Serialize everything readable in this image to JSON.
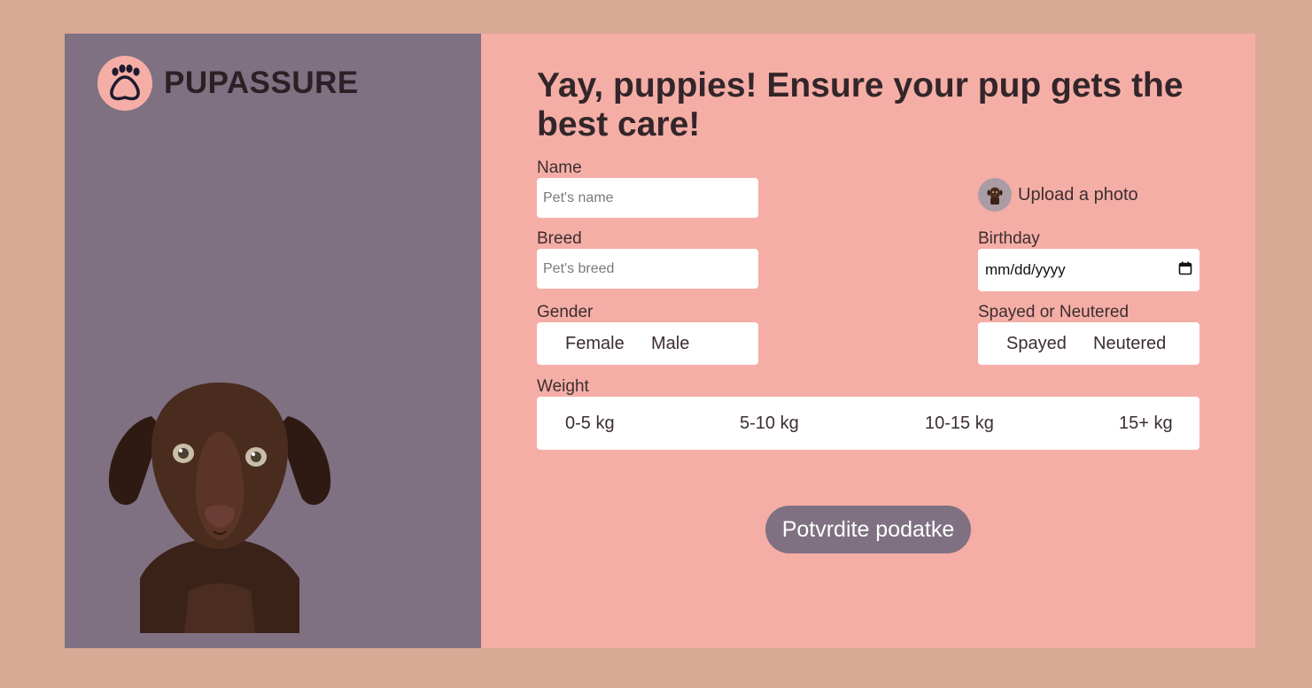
{
  "brand": {
    "name": "PUPASSURE",
    "logo_icon": "paw-icon"
  },
  "sidebar": {
    "image": "puppy-photo"
  },
  "form": {
    "title": "Yay, puppies! Ensure your pup gets the best care!",
    "name": {
      "label": "Name",
      "placeholder": "Pet's name"
    },
    "breed": {
      "label": "Breed",
      "placeholder": "Pet's breed"
    },
    "upload": {
      "label": "Upload a photo",
      "icon": "puppy-avatar-icon"
    },
    "birthday": {
      "label": "Birthday",
      "value": "mm/dd/yyyy",
      "icon": "calendar-icon"
    },
    "gender": {
      "label": "Gender",
      "options": [
        "Female",
        "Male"
      ]
    },
    "spayed": {
      "label": "Spayed or Neutered",
      "options": [
        "Spayed",
        "Neutered"
      ]
    },
    "weight": {
      "label": "Weight",
      "options": [
        "0-5 kg",
        "5-10 kg",
        "10-15 kg",
        "15+ kg"
      ]
    },
    "submit_label": "Potvrdite podatke"
  },
  "colors": {
    "page_bg": "#d8a995",
    "sidebar_bg": "#7f7182",
    "form_bg": "#f5aea6",
    "button_bg": "#7f7182"
  }
}
